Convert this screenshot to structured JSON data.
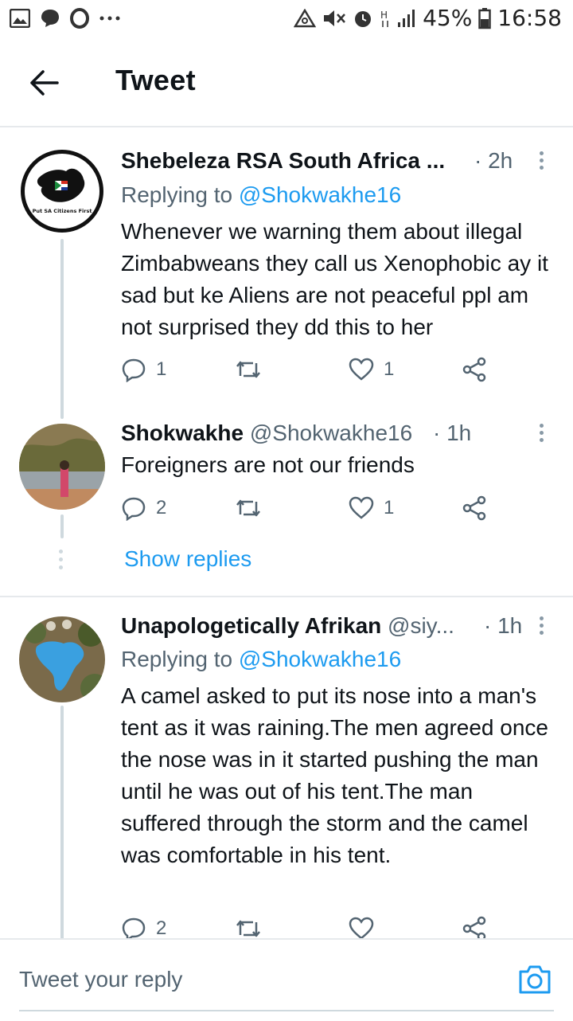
{
  "status_bar": {
    "battery": "45%",
    "time": "16:58",
    "icons_left": [
      "gallery-icon",
      "chat-icon",
      "opera-icon",
      "more-dots-icon"
    ],
    "icons_right": [
      "data-saver-icon",
      "mute-icon",
      "alarm-icon",
      "network-h-icon",
      "signal-icon",
      "battery-icon"
    ]
  },
  "header": {
    "title": "Tweet"
  },
  "tweets": [
    {
      "name": "Shebeleza RSA South Africa ...",
      "time": "· 2h",
      "replying_prefix": "Replying to",
      "replying_to": "@Shokwakhe16",
      "avatar_text": "Put SA Citizens First",
      "text": "Whenever we warning them about illegal Zimbabweans they call us Xenophobic ay it sad but ke Aliens are not peaceful ppl am not surprised they dd this to her",
      "replies": "1",
      "retweets": "",
      "likes": "1"
    },
    {
      "name": "Shokwakhe",
      "handle": "@Shokwakhe16",
      "time": "· 1h",
      "text": "Foreigners are not our friends",
      "replies": "2",
      "retweets": "",
      "likes": "1"
    },
    {
      "name": "Unapologetically Afrikan",
      "handle": "@siy...",
      "time": "· 1h",
      "replying_prefix": "Replying to",
      "replying_to": "@Shokwakhe16",
      "text": "A camel asked to put its nose into a man's tent as it was raining.The men agreed once the nose was in it started pushing the man until he was out of his tent.The man suffered through the storm and the camel was comfortable in his tent.",
      "replies": "2",
      "retweets": "",
      "likes": ""
    }
  ],
  "show_replies": "Show replies",
  "reply_bar": {
    "placeholder": "Tweet your reply"
  },
  "colors": {
    "accent": "#1d9bf0",
    "secondary_text": "#536471",
    "divider": "#e6e9ec"
  }
}
